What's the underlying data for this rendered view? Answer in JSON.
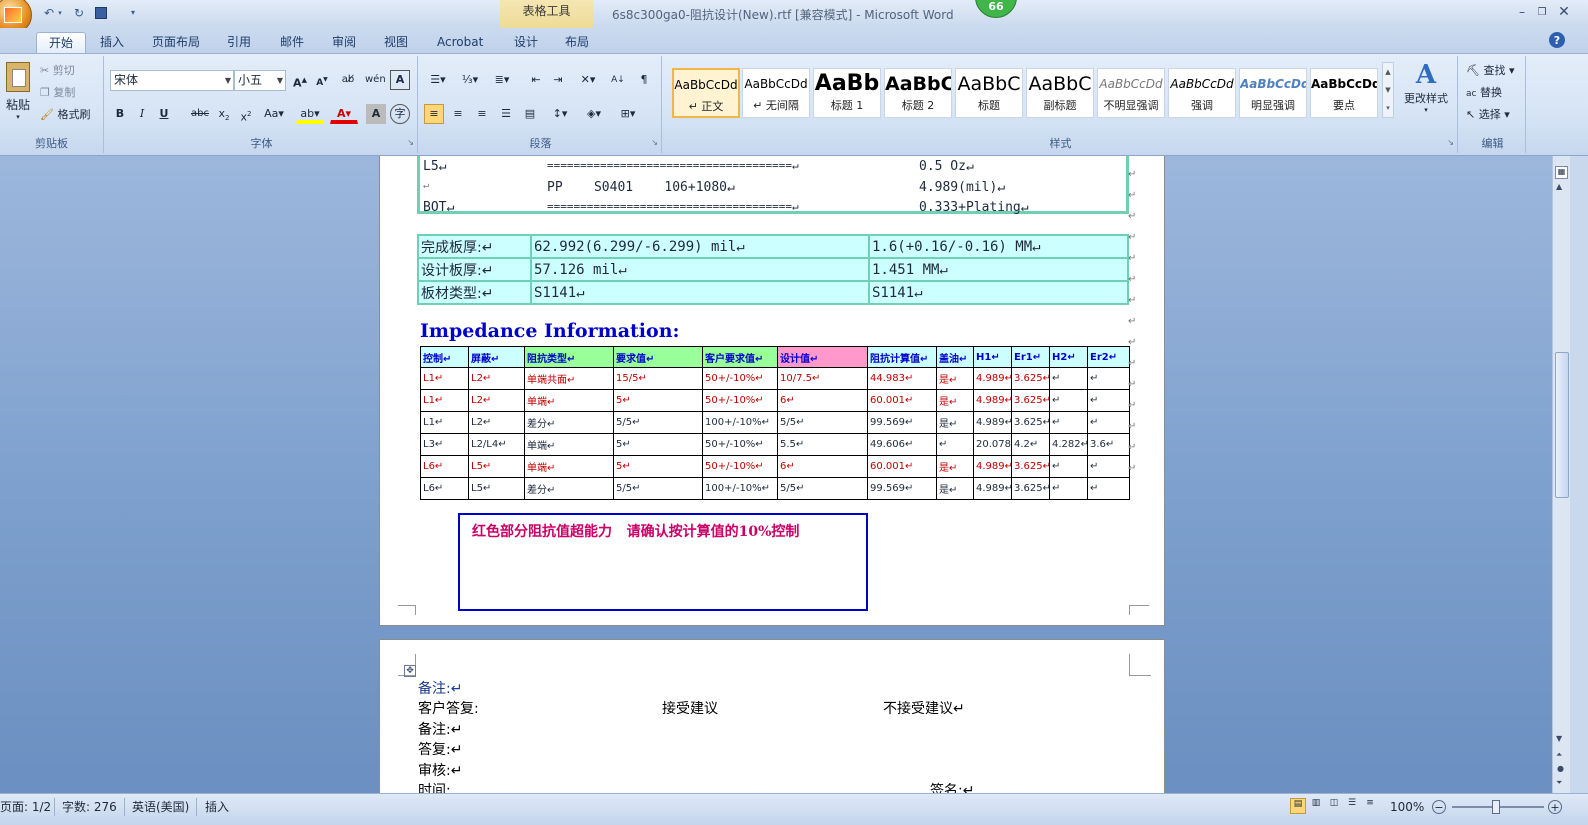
{
  "window": {
    "title": "6s8c300ga0-阻抗设计(New).rtf [兼容模式] - Microsoft Word",
    "context_tab": "表格工具",
    "badge": "66"
  },
  "tabs": [
    "开始",
    "插入",
    "页面布局",
    "引用",
    "邮件",
    "审阅",
    "视图",
    "Acrobat",
    "设计",
    "布局"
  ],
  "clipboard": {
    "paste": "粘贴",
    "cut": "剪切",
    "copy": "复制",
    "format_painter": "格式刷",
    "label": "剪贴板"
  },
  "font": {
    "name": "宋体",
    "size": "小五",
    "label": "字体"
  },
  "paragraph": {
    "label": "段落"
  },
  "styles": {
    "label": "样式",
    "items": [
      {
        "sample": "AaBbCcDd",
        "name": "↵ 正文"
      },
      {
        "sample": "AaBbCcDd",
        "name": "↵ 无间隔"
      },
      {
        "sample": "AaBb",
        "name": "标题 1"
      },
      {
        "sample": "AaBbC",
        "name": "标题 2"
      },
      {
        "sample": "AaBbC",
        "name": "标题"
      },
      {
        "sample": "AaBbC",
        "name": "副标题"
      },
      {
        "sample": "AaBbCcDd",
        "name": "不明显强调"
      },
      {
        "sample": "AaBbCcDd",
        "name": "强调"
      },
      {
        "sample": "AaBbCcDd",
        "name": "明显强调"
      },
      {
        "sample": "AaBbCcDd",
        "name": "要点"
      }
    ],
    "change": "更改样式"
  },
  "editing": {
    "find": "查找",
    "replace": "替换",
    "select": "选择",
    "label": "编辑"
  },
  "stackup": [
    {
      "layer": "L5↵",
      "line": "=====================================↵",
      "value": "0.5 Oz↵"
    },
    {
      "layer": "↵",
      "line": "PP    S0401    106+1080↵",
      "value": "4.989(mil)↵"
    },
    {
      "layer": "BOT↵",
      "line": "=====================================↵",
      "value": "0.333+Plating↵"
    }
  ],
  "board": [
    {
      "label": "完成板厚:↵",
      "value": "62.992(6.299/-6.299) mil↵",
      "metric": "1.6(+0.16/-0.16) MM↵"
    },
    {
      "label": "设计板厚:↵",
      "value": "57.126 mil↵",
      "metric": "1.451 MM↵"
    },
    {
      "label": "板材类型:↵",
      "value": "S1141↵",
      "metric": "S1141↵"
    }
  ],
  "impedance_title": "Impedance Information:",
  "impedance_headers": [
    "控制↵",
    "屏蔽↵",
    "阻抗类型↵",
    "要求值↵",
    "客户要求值↵",
    "设计值↵",
    "阻抗计算值↵",
    "盖油↵",
    "H1↵",
    "Er1↵",
    "H2↵",
    "Er2↵"
  ],
  "impedance_rows": [
    {
      "red": true,
      "cells": [
        "L1↵",
        "L2↵",
        "单端共面↵",
        "15/5↵",
        "50+/-10%↵",
        "10/7.5↵",
        "44.983↵",
        "是↵",
        "4.989↵",
        "3.625↵",
        "↵",
        "↵"
      ]
    },
    {
      "red": true,
      "cells": [
        "L1↵",
        "L2↵",
        "单端↵",
        "5↵",
        "50+/-10%↵",
        "6↵",
        "60.001↵",
        "是↵",
        "4.989↵",
        "3.625↵",
        "↵",
        "↵"
      ]
    },
    {
      "red": false,
      "cells": [
        "L1↵",
        "L2↵",
        "差分↵",
        "5/5↵",
        "100+/-10%↵",
        "5/5↵",
        "99.569↵",
        "是↵",
        "4.989↵",
        "3.625↵",
        "↵",
        "↵"
      ]
    },
    {
      "red": false,
      "cells": [
        "L3↵",
        "L2/L4↵",
        "单端↵",
        "5↵",
        "50+/-10%↵",
        "5.5↵",
        "49.606↵",
        "↵",
        "20.078↵",
        "4.2↵",
        "4.282↵",
        "3.6↵"
      ]
    },
    {
      "red": true,
      "cells": [
        "L6↵",
        "L5↵",
        "单端↵",
        "5↵",
        "50+/-10%↵",
        "6↵",
        "60.001↵",
        "是↵",
        "4.989↵",
        "3.625↵",
        "↵",
        "↵"
      ]
    },
    {
      "red": false,
      "cells": [
        "L6↵",
        "L5↵",
        "差分↵",
        "5/5↵",
        "100+/-10%↵",
        "5/5↵",
        "99.569↵",
        "是↵",
        "4.989↵",
        "3.625↵",
        "↵",
        "↵"
      ]
    }
  ],
  "note_box": "红色部分阻抗值超能力   请确认按计算值的10%控制",
  "page2": {
    "remark": "备注:↵",
    "reply": "客户答复:",
    "accept": "接受建议",
    "reject": "不接受建议↵",
    "remark2": "备注:↵",
    "answer": "答复:↵",
    "review": "审核:↵",
    "time": "时间:",
    "sign": "签名:↵"
  },
  "status": {
    "page": "页面: 1/2",
    "words": "字数: 276",
    "lang": "英语(美国)",
    "mode": "插入",
    "zoom": "100%"
  },
  "colors": {
    "table_border": "#6ed1b4",
    "table_fill": "#ccffff",
    "red_text": "#c00000",
    "header_blue": "#0000cc",
    "design_col": "#ff99cc",
    "note_border": "#0000cc",
    "note_text": "#cc0066"
  }
}
